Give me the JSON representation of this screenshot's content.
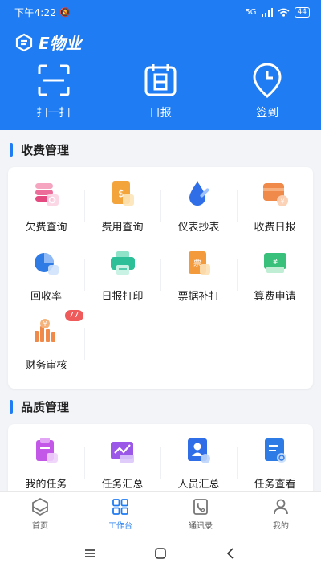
{
  "status_bar": {
    "time": "下午4:22",
    "network": "5G",
    "battery": "44"
  },
  "app": {
    "title": "E物业"
  },
  "quick_actions": [
    {
      "label": "扫一扫",
      "icon": "scan-icon"
    },
    {
      "label": "日报",
      "icon": "daily-report-icon"
    },
    {
      "label": "签到",
      "icon": "checkin-icon"
    }
  ],
  "sections": {
    "fee": {
      "title": "收费管理",
      "items": [
        {
          "label": "欠费查询",
          "icon": "arrears-query-icon"
        },
        {
          "label": "费用查询",
          "icon": "fee-query-icon"
        },
        {
          "label": "仪表抄表",
          "icon": "meter-reading-icon"
        },
        {
          "label": "收费日报",
          "icon": "fee-daily-icon"
        },
        {
          "label": "回收率",
          "icon": "recovery-rate-icon"
        },
        {
          "label": "日报打印",
          "icon": "print-icon"
        },
        {
          "label": "票据补打",
          "icon": "invoice-reprint-icon"
        },
        {
          "label": "算费申请",
          "icon": "fee-apply-icon"
        },
        {
          "label": "财务审核",
          "icon": "finance-audit-icon",
          "badge": "77"
        }
      ]
    },
    "quality": {
      "title": "品质管理",
      "items": [
        {
          "label": "我的任务",
          "icon": "my-task-icon"
        },
        {
          "label": "任务汇总",
          "icon": "task-summary-icon"
        },
        {
          "label": "人员汇总",
          "icon": "staff-summary-icon"
        },
        {
          "label": "任务查看",
          "icon": "task-view-icon"
        }
      ]
    }
  },
  "tabbar": [
    {
      "label": "首页",
      "icon": "home-icon",
      "active": false
    },
    {
      "label": "工作台",
      "icon": "workbench-icon",
      "active": true
    },
    {
      "label": "通讯录",
      "icon": "contacts-icon",
      "active": false
    },
    {
      "label": "我的",
      "icon": "profile-icon",
      "active": false
    }
  ],
  "colors": {
    "primary": "#1f7cf2",
    "badge": "#ef5a5a"
  }
}
